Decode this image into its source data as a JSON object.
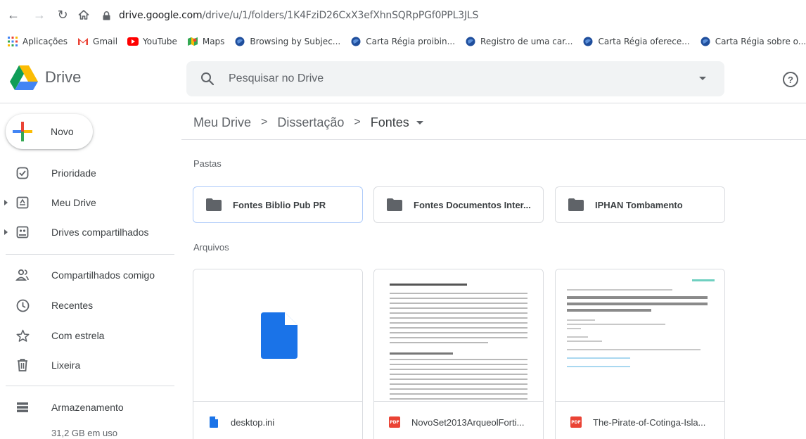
{
  "browser": {
    "url_host": "drive.google.com",
    "url_path": "/drive/u/1/folders/1K4FziD26CxX3efXhnSQRpPGf0PPL3JLS",
    "bookmarks": [
      {
        "label": "Aplicações",
        "icon": "apps-grid-icon"
      },
      {
        "label": "Gmail",
        "icon": "gmail-icon"
      },
      {
        "label": "YouTube",
        "icon": "youtube-icon"
      },
      {
        "label": "Maps",
        "icon": "maps-icon"
      },
      {
        "label": "Browsing by Subjec...",
        "icon": "globe-icon"
      },
      {
        "label": "Carta Régia proibin...",
        "icon": "globe-icon"
      },
      {
        "label": "Registro de uma car...",
        "icon": "globe-icon"
      },
      {
        "label": "Carta Régia oferece...",
        "icon": "globe-icon"
      },
      {
        "label": "Carta Régia sobre o...",
        "icon": "globe-icon"
      }
    ]
  },
  "header": {
    "app_name": "Drive",
    "search_placeholder": "Pesquisar no Drive",
    "help_label": "?"
  },
  "sidebar": {
    "new_label": "Novo",
    "items": [
      {
        "label": "Prioridade",
        "icon": "priority-check-icon"
      },
      {
        "label": "Meu Drive",
        "icon": "my-drive-icon"
      },
      {
        "label": "Drives compartilhados",
        "icon": "shared-drives-icon"
      },
      {
        "label": "Compartilhados comigo",
        "icon": "shared-with-me-icon"
      },
      {
        "label": "Recentes",
        "icon": "clock-icon"
      },
      {
        "label": "Com estrela",
        "icon": "star-icon"
      },
      {
        "label": "Lixeira",
        "icon": "trash-icon"
      },
      {
        "label": "Armazenamento",
        "icon": "storage-icon"
      }
    ],
    "storage_used": "31,2 GB em uso"
  },
  "main": {
    "breadcrumb": [
      "Meu Drive",
      "Dissertação",
      "Fontes"
    ],
    "folders_title": "Pastas",
    "files_title": "Arquivos",
    "folders": [
      {
        "label": "Fontes Biblio Pub PR",
        "selected": true
      },
      {
        "label": "Fontes Documentos Inter...",
        "selected": false
      },
      {
        "label": "IPHAN Tombamento",
        "selected": false
      }
    ],
    "files": [
      {
        "label": "desktop.ini",
        "type": "generic-file"
      },
      {
        "label": "NovoSet2013ArqueolForti...",
        "type": "pdf"
      },
      {
        "label": "The-Pirate-of-Cotinga-Isla...",
        "type": "pdf"
      }
    ]
  },
  "colors": {
    "google_blue": "#1a73e8",
    "pdf_red": "#ea4335",
    "selected_border": "#aecbfa"
  }
}
